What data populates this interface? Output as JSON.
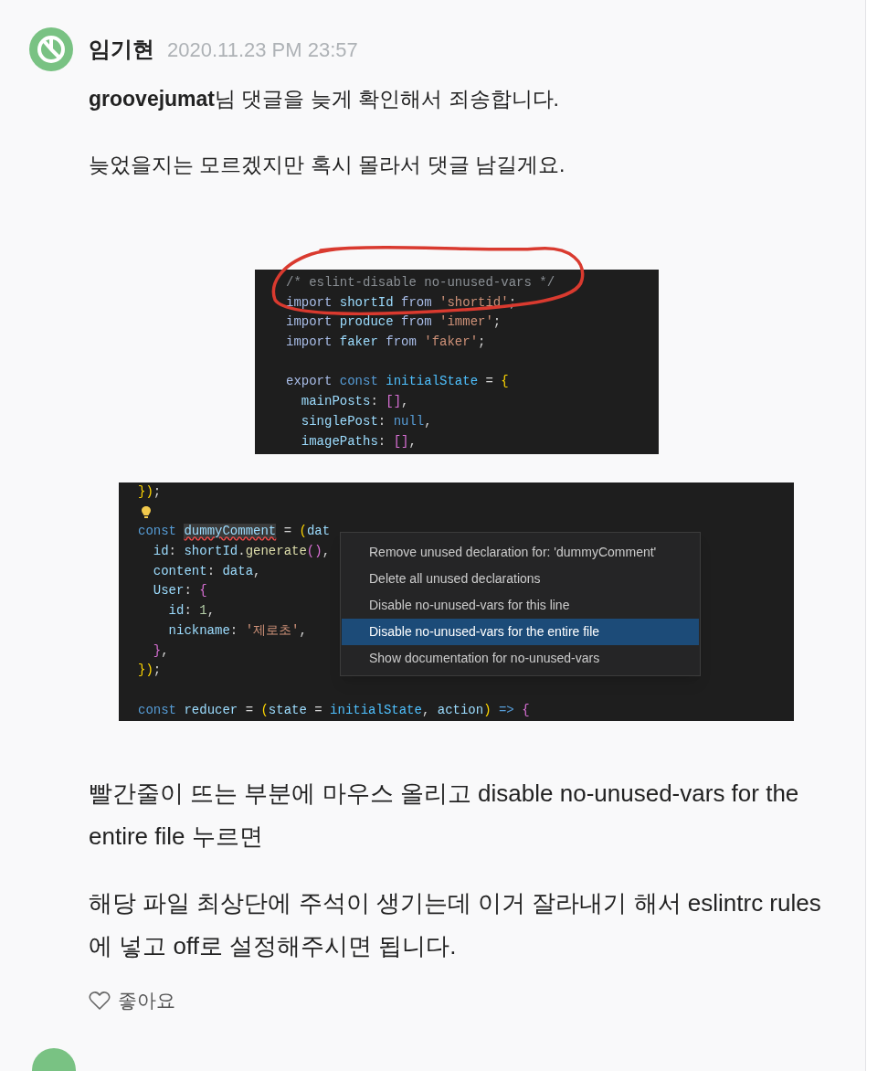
{
  "comment": {
    "author": "임기현",
    "date": "2020.11.23 PM 23:57",
    "paragraphs_before": [
      "**groovejumat**님 댓글을 늦게 확인해서 죄송합니다.",
      "늦었을지는 모르겠지만 혹시 몰라서 댓글 남길게요."
    ],
    "code_image_1": {
      "lines": [
        {
          "kind": "code",
          "tokens": [
            {
              "text": "/* eslint-disable no-unused-vars */",
              "kind": "comment"
            }
          ]
        },
        {
          "kind": "code",
          "tokens": [
            {
              "text": "import ",
              "kind": "import"
            },
            {
              "text": "shortId ",
              "kind": "var"
            },
            {
              "text": "from ",
              "kind": "import"
            },
            {
              "text": "'shortid'",
              "kind": "string"
            },
            {
              "text": ";",
              "kind": "plain"
            }
          ]
        },
        {
          "kind": "code",
          "tokens": [
            {
              "text": "import ",
              "kind": "import"
            },
            {
              "text": "produce ",
              "kind": "var"
            },
            {
              "text": "from ",
              "kind": "import"
            },
            {
              "text": "'immer'",
              "kind": "string"
            },
            {
              "text": ";",
              "kind": "plain"
            }
          ]
        },
        {
          "kind": "code",
          "tokens": [
            {
              "text": "import ",
              "kind": "import"
            },
            {
              "text": "faker ",
              "kind": "var"
            },
            {
              "text": "from ",
              "kind": "import"
            },
            {
              "text": "'faker'",
              "kind": "string"
            },
            {
              "text": ";",
              "kind": "plain"
            }
          ]
        },
        {
          "kind": "blank"
        },
        {
          "kind": "code",
          "tokens": [
            {
              "text": "export ",
              "kind": "import"
            },
            {
              "text": "const ",
              "kind": "keyword"
            },
            {
              "text": "initialState",
              "kind": "constant"
            },
            {
              "text": " = ",
              "kind": "plain"
            },
            {
              "text": "{",
              "kind": "bracket"
            }
          ]
        },
        {
          "kind": "code",
          "tokens": [
            {
              "text": "  mainPosts",
              "kind": "var"
            },
            {
              "text": ": ",
              "kind": "plain"
            },
            {
              "text": "[]",
              "kind": "bracket2"
            },
            {
              "text": ",",
              "kind": "plain"
            }
          ]
        },
        {
          "kind": "code",
          "tokens": [
            {
              "text": "  singlePost",
              "kind": "var"
            },
            {
              "text": ": ",
              "kind": "plain"
            },
            {
              "text": "null",
              "kind": "keyword"
            },
            {
              "text": ",",
              "kind": "plain"
            }
          ]
        },
        {
          "kind": "code",
          "tokens": [
            {
              "text": "  imagePaths",
              "kind": "var"
            },
            {
              "text": ": ",
              "kind": "plain"
            },
            {
              "text": "[]",
              "kind": "bracket2"
            },
            {
              "text": ",",
              "kind": "plain"
            }
          ]
        }
      ]
    },
    "code_image_2": {
      "lines": [
        {
          "kind": "code",
          "tokens": [
            {
              "text": "})",
              "kind": "bracket"
            },
            {
              "text": ";",
              "kind": "plain"
            }
          ]
        },
        {
          "kind": "lightbulb"
        },
        {
          "kind": "code",
          "tokens": [
            {
              "text": "const ",
              "kind": "keyword"
            },
            {
              "text": "dummyComment",
              "kind": "var",
              "squiggle": true
            },
            {
              "text": " = ",
              "kind": "plain"
            },
            {
              "text": "(",
              "kind": "bracket"
            },
            {
              "text": "dat",
              "kind": "var"
            }
          ]
        },
        {
          "kind": "code",
          "tokens": [
            {
              "text": "  id",
              "kind": "var"
            },
            {
              "text": ": ",
              "kind": "plain"
            },
            {
              "text": "shortId",
              "kind": "var"
            },
            {
              "text": ".",
              "kind": "plain"
            },
            {
              "text": "generate",
              "kind": "function"
            },
            {
              "text": "()",
              "kind": "bracket2"
            },
            {
              "text": ",",
              "kind": "plain"
            }
          ]
        },
        {
          "kind": "code",
          "tokens": [
            {
              "text": "  content",
              "kind": "var"
            },
            {
              "text": ": ",
              "kind": "plain"
            },
            {
              "text": "data",
              "kind": "var"
            },
            {
              "text": ",",
              "kind": "plain"
            }
          ]
        },
        {
          "kind": "code",
          "tokens": [
            {
              "text": "  User",
              "kind": "var"
            },
            {
              "text": ": ",
              "kind": "plain"
            },
            {
              "text": "{",
              "kind": "bracket2"
            }
          ]
        },
        {
          "kind": "code",
          "tokens": [
            {
              "text": "    id",
              "kind": "var"
            },
            {
              "text": ": ",
              "kind": "plain"
            },
            {
              "text": "1",
              "kind": "number"
            },
            {
              "text": ",",
              "kind": "plain"
            }
          ]
        },
        {
          "kind": "code",
          "tokens": [
            {
              "text": "    nickname",
              "kind": "var"
            },
            {
              "text": ": ",
              "kind": "plain"
            },
            {
              "text": "'제로초'",
              "kind": "string"
            },
            {
              "text": ",",
              "kind": "plain"
            }
          ]
        },
        {
          "kind": "code",
          "tokens": [
            {
              "text": "  }",
              "kind": "bracket2"
            },
            {
              "text": ",",
              "kind": "plain"
            }
          ]
        },
        {
          "kind": "code",
          "tokens": [
            {
              "text": "})",
              "kind": "bracket"
            },
            {
              "text": ";",
              "kind": "plain"
            }
          ]
        },
        {
          "kind": "blank"
        },
        {
          "kind": "code",
          "tokens": [
            {
              "text": "const ",
              "kind": "keyword"
            },
            {
              "text": "reducer",
              "kind": "var"
            },
            {
              "text": " = ",
              "kind": "plain"
            },
            {
              "text": "(",
              "kind": "bracket"
            },
            {
              "text": "state",
              "kind": "var"
            },
            {
              "text": " = ",
              "kind": "plain"
            },
            {
              "text": "initialState",
              "kind": "constant"
            },
            {
              "text": ", ",
              "kind": "plain"
            },
            {
              "text": "action",
              "kind": "var"
            },
            {
              "text": ")",
              "kind": "bracket"
            },
            {
              "text": " => ",
              "kind": "keyword"
            },
            {
              "text": "{",
              "kind": "bracket2"
            }
          ]
        }
      ],
      "menu": [
        {
          "label": "Remove unused declaration for: 'dummyComment'",
          "selected": false
        },
        {
          "label": "Delete all unused declarations",
          "selected": false
        },
        {
          "label": "Disable no-unused-vars for this line",
          "selected": false
        },
        {
          "label": "Disable no-unused-vars for the entire file",
          "selected": true
        },
        {
          "label": "Show documentation for no-unused-vars",
          "selected": false
        }
      ]
    },
    "paragraphs_after": [
      "빨간줄이 뜨는 부분에 마우스 올리고 disable no-unused-vars for the entire file 누르면",
      "해당 파일 최상단에 주석이 생기는데 이거 잘라내기 해서 eslintrc rules에 넣고 off로 설정해주시면 됩니다."
    ],
    "like_label": "좋아요"
  }
}
